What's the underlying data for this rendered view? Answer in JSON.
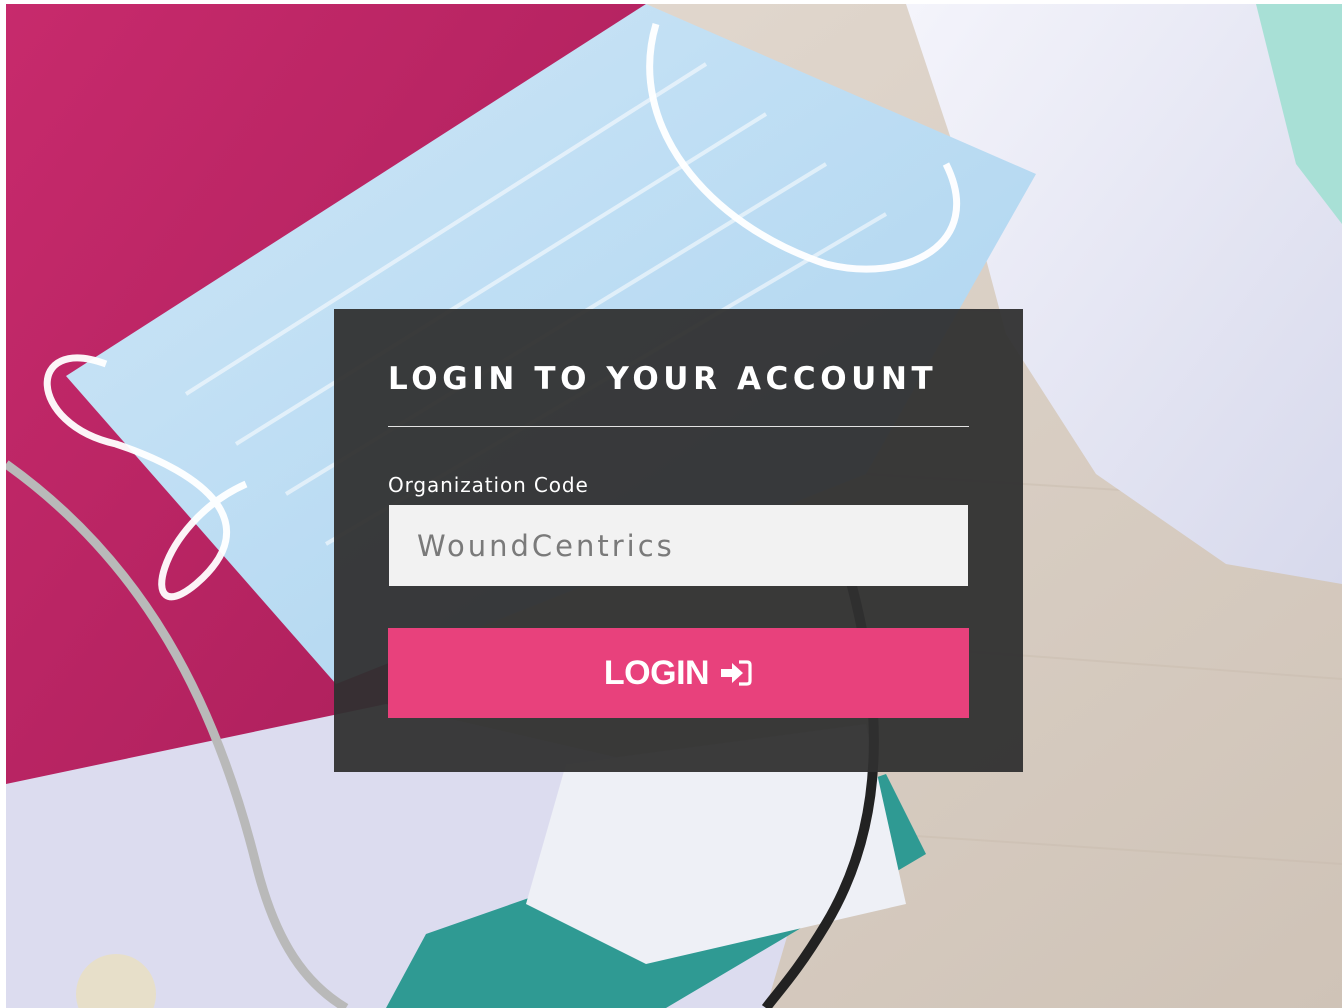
{
  "panel": {
    "title": "LOGIN TO YOUR ACCOUNT",
    "org_code_label": "Organization Code",
    "org_code_value": "WoundCentrics",
    "login_label": "LOGIN",
    "login_icon": "sign-in-icon"
  },
  "colors": {
    "panel_bg": "#303030",
    "accent": "#e8417c",
    "input_bg": "#f2f2f2",
    "input_text": "#7a7a7a"
  }
}
